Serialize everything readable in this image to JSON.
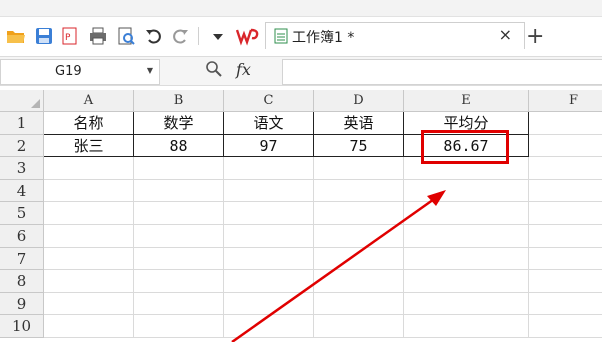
{
  "toolbar": {
    "doc_tab_label": "工作簿1 *",
    "close_symbol": "×",
    "add_symbol": "+"
  },
  "formula_bar": {
    "cell_ref": "G19",
    "fx": "fx"
  },
  "sheet": {
    "columns": [
      "A",
      "B",
      "C",
      "D",
      "E",
      "F"
    ],
    "rows": [
      "1",
      "2",
      "3",
      "4",
      "5",
      "6",
      "7",
      "8",
      "9",
      "10"
    ],
    "header_row": [
      "名称",
      "数学",
      "语文",
      "英语",
      "平均分"
    ],
    "data_row": [
      "张三",
      "88",
      "97",
      "75",
      "86.67"
    ]
  },
  "colors": {
    "highlight": "#e00000",
    "wps_red": "#d9262b"
  }
}
